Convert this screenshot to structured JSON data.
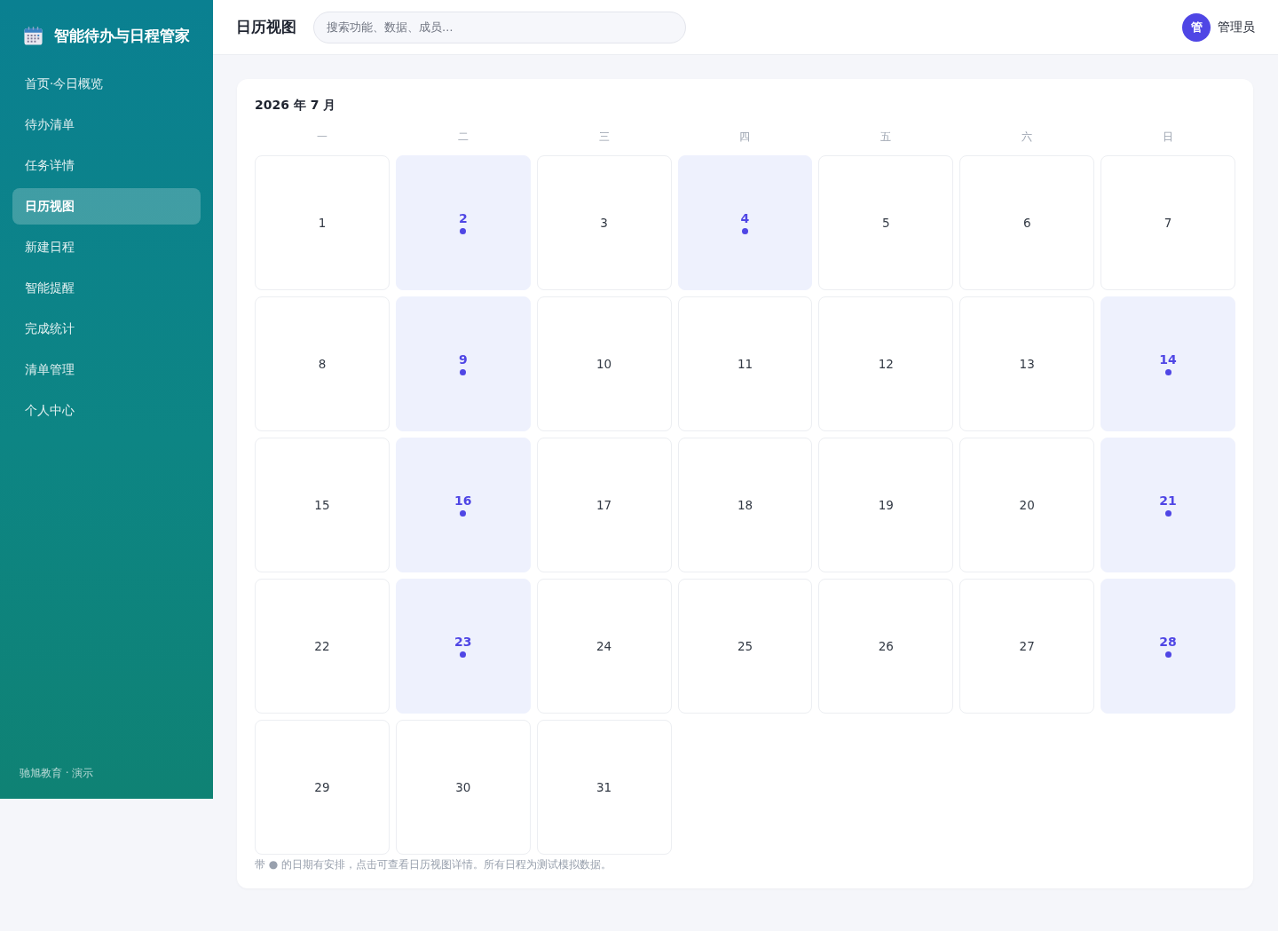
{
  "sidebar": {
    "brand": "智能待办与日程管家",
    "items": [
      {
        "label": "首页·今日概览",
        "selected": false
      },
      {
        "label": "待办清单",
        "selected": false
      },
      {
        "label": "任务详情",
        "selected": false
      },
      {
        "label": "日历视图",
        "selected": true
      },
      {
        "label": "新建日程",
        "selected": false
      },
      {
        "label": "智能提醒",
        "selected": false
      },
      {
        "label": "完成统计",
        "selected": false
      },
      {
        "label": "清单管理",
        "selected": false
      },
      {
        "label": "个人中心",
        "selected": false
      }
    ],
    "footer": "驰旭教育 · 演示"
  },
  "header": {
    "title": "日历视图",
    "search": {
      "placeholder": "搜索功能、数据、成员…"
    },
    "user": {
      "avatar_text": "管",
      "name": "管理员"
    }
  },
  "calendar": {
    "title": "2026 年 7 月",
    "weekdays": [
      "一",
      "二",
      "三",
      "四",
      "五",
      "六",
      "日"
    ],
    "days": [
      {
        "label": "1",
        "has_event": false
      },
      {
        "label": "2",
        "has_event": true
      },
      {
        "label": "3",
        "has_event": false
      },
      {
        "label": "4",
        "has_event": true
      },
      {
        "label": "5",
        "has_event": false
      },
      {
        "label": "6",
        "has_event": false
      },
      {
        "label": "7",
        "has_event": false
      },
      {
        "label": "8",
        "has_event": false
      },
      {
        "label": "9",
        "has_event": true
      },
      {
        "label": "10",
        "has_event": false
      },
      {
        "label": "11",
        "has_event": false
      },
      {
        "label": "12",
        "has_event": false
      },
      {
        "label": "13",
        "has_event": false
      },
      {
        "label": "14",
        "has_event": true
      },
      {
        "label": "15",
        "has_event": false
      },
      {
        "label": "16",
        "has_event": true
      },
      {
        "label": "17",
        "has_event": false
      },
      {
        "label": "18",
        "has_event": false
      },
      {
        "label": "19",
        "has_event": false
      },
      {
        "label": "20",
        "has_event": false
      },
      {
        "label": "21",
        "has_event": true
      },
      {
        "label": "22",
        "has_event": false
      },
      {
        "label": "23",
        "has_event": true
      },
      {
        "label": "24",
        "has_event": false
      },
      {
        "label": "25",
        "has_event": false
      },
      {
        "label": "26",
        "has_event": false
      },
      {
        "label": "27",
        "has_event": false
      },
      {
        "label": "28",
        "has_event": true
      },
      {
        "label": "29",
        "has_event": false
      },
      {
        "label": "30",
        "has_event": false
      },
      {
        "label": "31",
        "has_event": false
      }
    ],
    "note": "带 ● 的日期有安排，点击可查看日历视图详情。所有日程为测试模拟数据。"
  }
}
